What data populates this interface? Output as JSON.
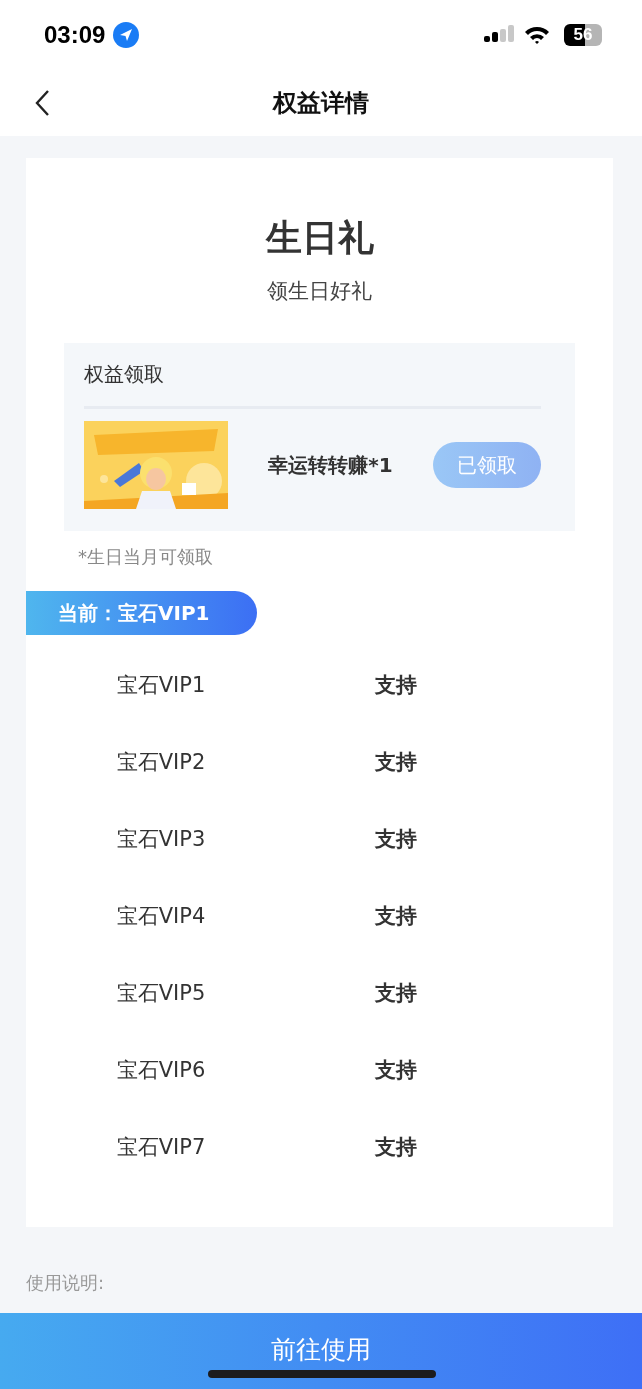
{
  "status_bar": {
    "time": "03:09",
    "battery": "56"
  },
  "nav": {
    "title": "权益详情"
  },
  "benefit": {
    "title": "生日礼",
    "subtitle": "领生日好礼"
  },
  "claim": {
    "heading": "权益领取",
    "item": {
      "kind": "picture",
      "name": "幸运转转赚*1",
      "button": "已领取",
      "claimed": true
    },
    "note": "*生日当月可领取"
  },
  "current_level": "当前：宝石VIP1",
  "levels": [
    {
      "name": "宝石VIP1",
      "support": "支持"
    },
    {
      "name": "宝石VIP2",
      "support": "支持"
    },
    {
      "name": "宝石VIP3",
      "support": "支持"
    },
    {
      "name": "宝石VIP4",
      "support": "支持"
    },
    {
      "name": "宝石VIP5",
      "support": "支持"
    },
    {
      "name": "宝石VIP6",
      "support": "支持"
    },
    {
      "name": "宝石VIP7",
      "support": "支持"
    }
  ],
  "usage": {
    "heading": "使用说明:"
  },
  "action_button": "前往使用"
}
